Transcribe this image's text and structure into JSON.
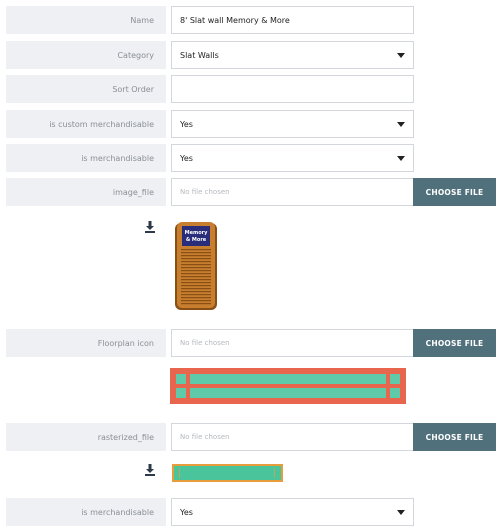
{
  "fields": {
    "name": {
      "label": "Name",
      "value": "8' Slat wall Memory & More"
    },
    "category": {
      "label": "Category",
      "value": "Slat Walls"
    },
    "sort_order": {
      "label": "Sort Order",
      "value": ""
    },
    "is_custom_merchandisable": {
      "label": "is custom merchandisable",
      "value": "Yes"
    },
    "is_merchandisable": {
      "label": "is merchandisable",
      "value": "Yes"
    },
    "image_file": {
      "label": "image_file",
      "placeholder": "No file chosen",
      "button": "CHOOSE FILE"
    },
    "floorplan_icon": {
      "label": "Floorplan icon",
      "placeholder": "No file chosen",
      "button": "CHOOSE FILE"
    },
    "rasterized_file": {
      "label": "rasterized_file",
      "placeholder": "No file chosen",
      "button": "CHOOSE FILE"
    },
    "is_merchandisable_2": {
      "label": "is merchandisable",
      "value": "Yes"
    }
  },
  "preview": {
    "wall_sign_text": "Memory & More"
  },
  "colors": {
    "button_bg": "#50707c",
    "label_bg": "#eef0f3",
    "floorplan_border": "#e8664d",
    "floorplan_fill": "#5fcaa9",
    "raster_fill": "#4ac59b",
    "wall_wood": "#c47a2c",
    "sign_bg": "#2a2e7a"
  },
  "icons": {
    "download": "download-icon",
    "dropdown": "chevron-down-icon"
  }
}
